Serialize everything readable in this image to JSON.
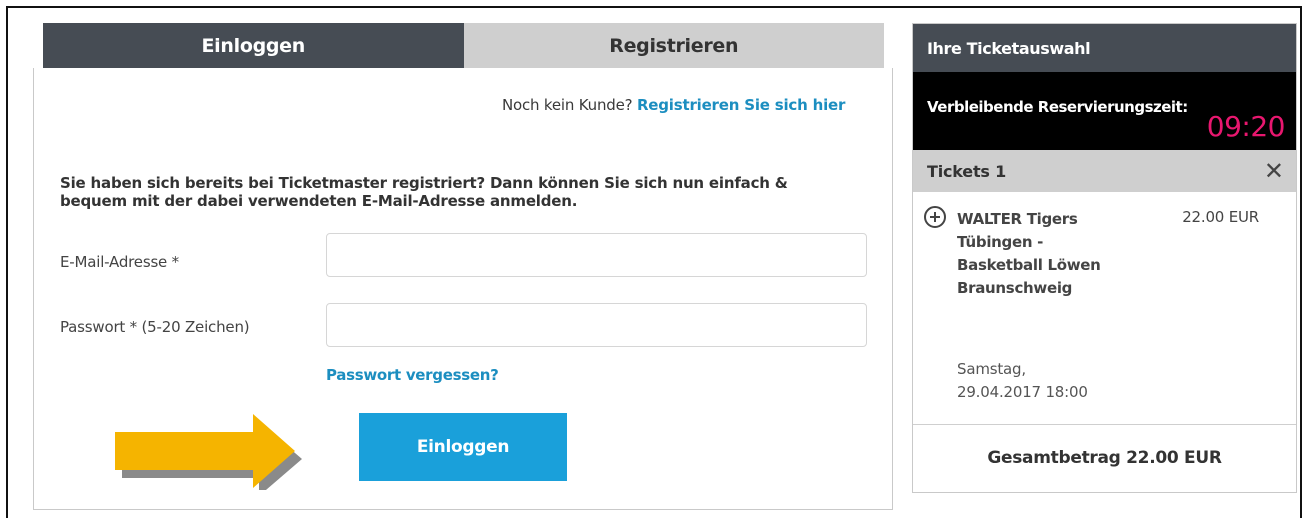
{
  "tabs": {
    "login": "Einloggen",
    "register": "Registrieren"
  },
  "register_prompt": {
    "text": "Noch kein Kunde?",
    "link": "Registrieren Sie sich hier"
  },
  "intro": "Sie haben sich bereits bei Ticketmaster registriert? Dann können Sie sich nun einfach & bequem mit der dabei verwendeten E-Mail-Adresse anmelden.",
  "form": {
    "email_label": "E-Mail-Adresse *",
    "email_value": "",
    "password_label": "Passwort * (5-20 Zeichen)",
    "password_value": "",
    "forgot_link": "Passwort vergessen?",
    "submit_label": "Einloggen"
  },
  "cart": {
    "title": "Ihre Ticketauswahl",
    "timer_label": "Verbleibende Reservierungszeit:",
    "timer_value": "09:20",
    "tickets_label": "Tickets 1",
    "item": {
      "name": "WALTER Tigers Tübingen - Basketball Löwen Braunschweig",
      "price": "22.00 EUR",
      "date_line1": "Samstag,",
      "date_line2": "29.04.2017 18:00"
    },
    "total": "Gesamtbetrag 22.00 EUR"
  },
  "colors": {
    "header_dark": "#464c54",
    "tab_inactive": "#cfcfcf",
    "accent_blue": "#1aa0da",
    "link_blue": "#1c8ec0",
    "timer_pink": "#e8176f",
    "arrow_yellow": "#f5b400"
  },
  "icons": {
    "add": "plus-circle-icon",
    "remove": "close-icon",
    "annotation": "arrow-right-icon"
  }
}
